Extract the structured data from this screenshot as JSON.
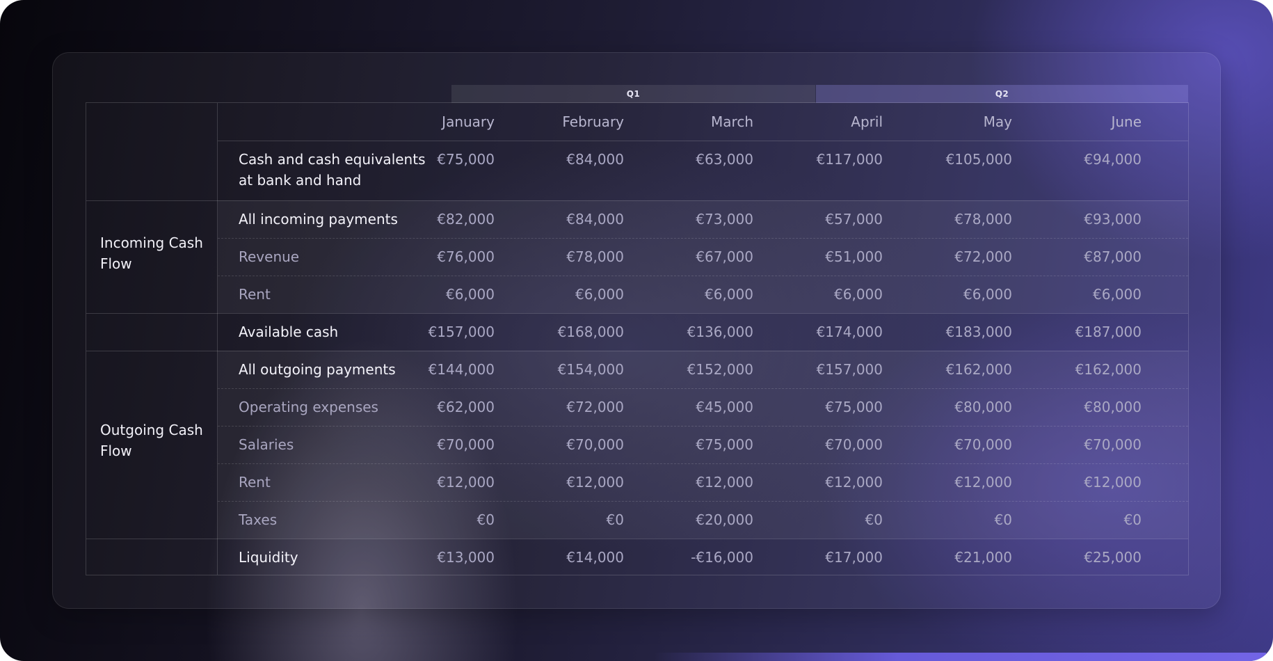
{
  "quarters": [
    {
      "label": "Q1"
    },
    {
      "label": "Q2"
    }
  ],
  "months": [
    "January",
    "February",
    "March",
    "April",
    "May",
    "June"
  ],
  "groups": {
    "incoming": "Incoming Cash Flow",
    "outgoing": "Outgoing Cash Flow"
  },
  "rows": [
    {
      "label": "Cash and cash equivalents at bank and hand",
      "values": [
        "€75,000",
        "€84,000",
        "€63,000",
        "€117,000",
        "€105,000",
        "€94,000"
      ]
    },
    {
      "label": "All incoming payments",
      "values": [
        "€82,000",
        "€84,000",
        "€73,000",
        "€57,000",
        "€78,000",
        "€93,000"
      ]
    },
    {
      "label": "Revenue",
      "values": [
        "€76,000",
        "€78,000",
        "€67,000",
        "€51,000",
        "€72,000",
        "€87,000"
      ]
    },
    {
      "label": "Rent",
      "values": [
        "€6,000",
        "€6,000",
        "€6,000",
        "€6,000",
        "€6,000",
        "€6,000"
      ]
    },
    {
      "label": "Available cash",
      "values": [
        "€157,000",
        "€168,000",
        "€136,000",
        "€174,000",
        "€183,000",
        "€187,000"
      ]
    },
    {
      "label": "All outgoing payments",
      "values": [
        "€144,000",
        "€154,000",
        "€152,000",
        "€157,000",
        "€162,000",
        "€162,000"
      ]
    },
    {
      "label": "Operating expenses",
      "values": [
        "€62,000",
        "€72,000",
        "€45,000",
        "€75,000",
        "€80,000",
        "€80,000"
      ]
    },
    {
      "label": "Salaries",
      "values": [
        "€70,000",
        "€70,000",
        "€75,000",
        "€70,000",
        "€70,000",
        "€70,000"
      ]
    },
    {
      "label": "Rent",
      "values": [
        "€12,000",
        "€12,000",
        "€12,000",
        "€12,000",
        "€12,000",
        "€12,000"
      ]
    },
    {
      "label": "Taxes",
      "values": [
        "€0",
        "€0",
        "€20,000",
        "€0",
        "€0",
        "€0"
      ]
    },
    {
      "label": "Liquidity",
      "values": [
        "€13,000",
        "€14,000",
        "-€16,000",
        "€17,000",
        "€21,000",
        "€25,000"
      ]
    }
  ],
  "colors": {
    "q2_band": "#5f58a8",
    "primary_text": "#f4f3fa",
    "secondary_text": "#a9a6c0"
  }
}
